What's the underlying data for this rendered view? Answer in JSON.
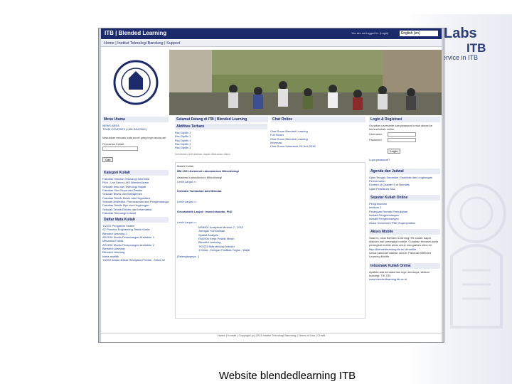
{
  "slide": {
    "caption": "Website blendedlearning ITB",
    "brand_top": "Labs",
    "brand_itb": "ITB",
    "brand_sub": "Service in ITB"
  },
  "browser": {
    "title": "ITB | Blended Learning",
    "login_status": "You are not logged in. (Login)",
    "language": "English (en)"
  },
  "navbar": {
    "text": "Home | Institut Teknologi Bandung | Support"
  },
  "left": {
    "menu_header": "Menu Utama",
    "menu_items": [
      "NEWS AREA",
      "TEAM COURSES (LMA SAVIGAS)"
    ],
    "search_text": "Masukkan sesuatu kata kunci yang ingin anda cari",
    "search_label": "Pencarian Kuliah :",
    "search_button": "Cari",
    "category_header": "Kategori Kuliah",
    "categories": [
      "Fakultas Sekolah Teknologi Informasi",
      "Pilot - Lan Demo LMS Blended-learn",
      "Sekolah Ilmu dan Teknologi Hayati",
      "Fakultas Seni Rupa dan Desain",
      "Sekolah Bisnis dan Manajemen",
      "Fakultas Teknik Mesin dan Dirgantara",
      "Sekolah Arsitektur, Perencanaan dan Pengembangan Kebijakan",
      "Fakultas Teknik Sipil dan Lingkungan",
      "Sekolah Teknik Elektro dan Informatika",
      "Fakultas Teknologi Industri"
    ],
    "course_header": "Daftar Mata Kuliah",
    "courses": [
      "TI2201 Pengantar Sistem",
      "S2 Process Engineering Teknik Kimia",
      "Blended Learning 2",
      "AR2106 Studio Perancangan Arsitektur 1",
      "Mekanika Fluida",
      "AR2206 Studio Perancangan Arsitektur 2",
      "Blended Learning",
      "Blended Learning",
      "kimia analitik",
      "TI2203 Dasar-Dasar Rekayasa Produk - Kelas 02"
    ]
  },
  "mid": {
    "welcome_header": "Selamat Datang di ITB | Blended Learning",
    "chat_header": "Chat Online",
    "aktifitas_header": "Aktifitas Terbaru",
    "aktifitas": [
      "Rsc Dipilih 1",
      "Rsc Dipilih 1",
      "Rsc Dipilih 1",
      "Rsc Dipilih 1",
      "Rsc Dipilih 1"
    ],
    "chat": [
      "Chat Room Blended Learning",
      "Fun Room",
      "Chat Room Blended Learning",
      "Informasi",
      "Chat Room Indonesia, 25 Nov 2018"
    ],
    "info_note": "Informasi perkuliahan dapat dilakukan disini",
    "materi_label": "Materi Kuliah",
    "course1": "BM-1001 Asistensi Laboratorium Mikrobiologi",
    "course1_desc": "Asistensi Laboratorium Mikrobiologi",
    "more1": "Lebih Lanjut >>",
    "course2": "Interaksi Tumbuhan dan Mikroba",
    "more2": "Lebih Lanjut >>",
    "course3": "Geostatistik Lanjut : Irwan Iskandar, PhD",
    "more3": "Lebih Lanjut >>",
    "list": [
      "MS8901 Analytical Method 2 - 2012",
      "Jaringan Komunikasi",
      "Spatial Analysis",
      "EM2006 Kerja Praktik Mesin",
      "Blended Learning",
      "TK3223 Mikrobiologi Industri",
      "1 Kelas - Dengan Fasilitas Tugas - Wajib"
    ],
    "more_list": "[Selengkapnya...]"
  },
  "right": {
    "login_header": "Login & Registrasi",
    "login_text": "Gunakan username dan password untuk akses ke semua kuliah online.",
    "username_label": "Username",
    "password_label": "Password",
    "login_button": "Login",
    "forgot": "Lupa password?",
    "agenda_header": "Agenda dan Jadwal",
    "agenda": [
      "Ujian Tengah Semester Geokimia dan Lingkungan Pencemaran",
      "Excerpt of Chapter 5 of Needles",
      "Ujian Praktikum SDL"
    ],
    "seputar_header": "Seputar Kuliah Online",
    "seputar": [
      "Pengumuman",
      "Infokom 1",
      "Pekerjaan Rumah Perkuliahan",
      "Inisiatif Pengembangan",
      "Inisiatif Pengembangan",
      "About Homework PBE Superposition"
    ],
    "mobile_header": "Akses Mobile",
    "mobile_text": "Saat ini, situs Blended Learning ITB sudah dapat diakses dari perangkat mobile. Gunakan browser pada perangkat mobile anda untuk mengakses situs ini.",
    "mobile_link": "http://blendedlearning.itb.ac.id/mobile",
    "mobile_text2": "Untuk panduan silakan unduh: Panduan Blended Learning Mobile",
    "inbox_header": "Inbox/ask Kuliah Online",
    "inbox_text": "Apabila ada kendala dan ingin bertanya, silakan hubungi: TIK ITB",
    "inbox_link": "www.blendedlearning.itb.ac.id"
  },
  "footer": {
    "text": "Home | Kontak | Copyright (c) 2013 Institut Teknologi Bandung | Terms of Use | Credit"
  }
}
